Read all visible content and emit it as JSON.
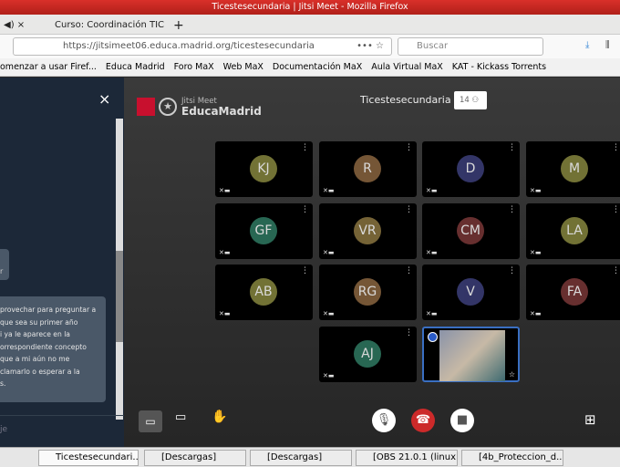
{
  "window": {
    "title": "Ticestesecundaria | Jitsi Meet - Mozilla Firefox"
  },
  "tabs": [
    {
      "label": "Curso: Coordinación TIC"
    }
  ],
  "nav": {
    "url": "https://jitsimeet06.educa.madrid.org/ticestesecundaria",
    "search_placeholder": "Buscar"
  },
  "bookmarks": [
    "omenzar a usar Firef...",
    "Educa Madrid",
    "Foro MaX",
    "Web MaX",
    "Documentación MaX",
    "Aula Virtual MaX",
    "KAT - Kickass Torrents"
  ],
  "chat": {
    "close": "×",
    "bubble_small": "r",
    "message_lines": [
      "provechar para preguntar a",
      "que sea su primer año",
      "i ya le aparece en la",
      "orrespondiente concepto",
      "que a mi aún no me",
      "clamarlo  o esperar a la",
      "s."
    ],
    "input_placeholder": "je"
  },
  "meeting": {
    "logo_top": "Jitsi Meet",
    "logo_bottom": "EducaMadrid",
    "room": "Ticestesecundaria",
    "participant_count": "14"
  },
  "participants": [
    {
      "initials": "KJ",
      "color": "#86863f"
    },
    {
      "initials": "R",
      "color": "#8a6540"
    },
    {
      "initials": "D",
      "color": "#3c3f7a"
    },
    {
      "initials": "M",
      "color": "#86863f"
    },
    {
      "initials": "GF",
      "color": "#2f7a62"
    },
    {
      "initials": "VR",
      "color": "#8a7540"
    },
    {
      "initials": "CM",
      "color": "#7a3838"
    },
    {
      "initials": "LA",
      "color": "#86863f"
    },
    {
      "initials": "AB",
      "color": "#86863f"
    },
    {
      "initials": "RG",
      "color": "#8a6540"
    },
    {
      "initials": "V",
      "color": "#3c3f7a"
    },
    {
      "initials": "FA",
      "color": "#7a3838"
    },
    {
      "initials": "AJ",
      "color": "#2f7a62"
    }
  ],
  "taskbar": [
    "Ticestesecundari...",
    "[Descargas]",
    "[Descargas]",
    "[OBS 21.0.1 (linux...",
    "[4b_Proteccion_d..."
  ]
}
